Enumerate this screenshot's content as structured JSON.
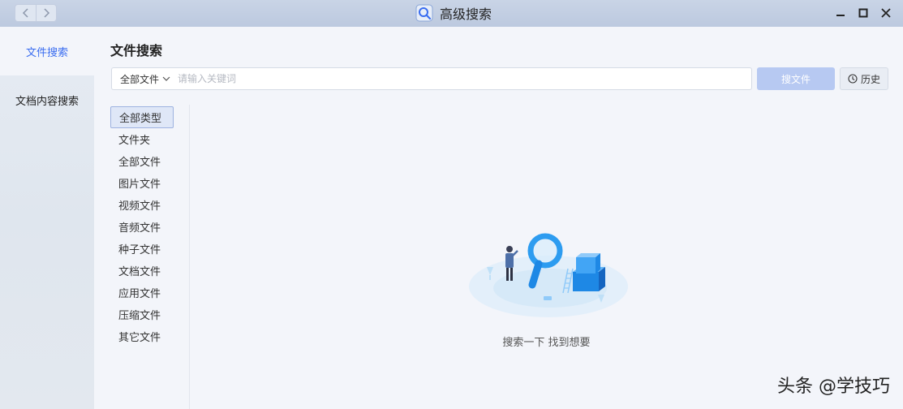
{
  "window": {
    "title": "高级搜索"
  },
  "sidebar": {
    "items": [
      {
        "label": "文件搜索",
        "active": true
      },
      {
        "label": "文档内容搜索",
        "active": false
      }
    ]
  },
  "main": {
    "title": "文件搜索",
    "search": {
      "scope_label": "全部文件",
      "placeholder": "请输入关键词",
      "value": "",
      "search_button": "搜文件",
      "history_button": "历史"
    },
    "types": [
      "全部类型",
      "文件夹",
      "全部文件",
      "图片文件",
      "视频文件",
      "音频文件",
      "种子文件",
      "文档文件",
      "应用文件",
      "压缩文件",
      "其它文件"
    ],
    "selected_type": "全部类型",
    "empty_state": "搜索一下 找到想要"
  },
  "watermark": "头条 @学技巧",
  "colors": {
    "accent": "#3a6df0",
    "search_button_bg": "#b7c9f2",
    "illustration_blue": "#2d9cf0"
  },
  "icons": [
    "back-icon",
    "forward-icon",
    "magnifier-app-icon",
    "minimize-icon",
    "maximize-icon",
    "close-icon",
    "chevron-down-icon",
    "clock-icon"
  ]
}
